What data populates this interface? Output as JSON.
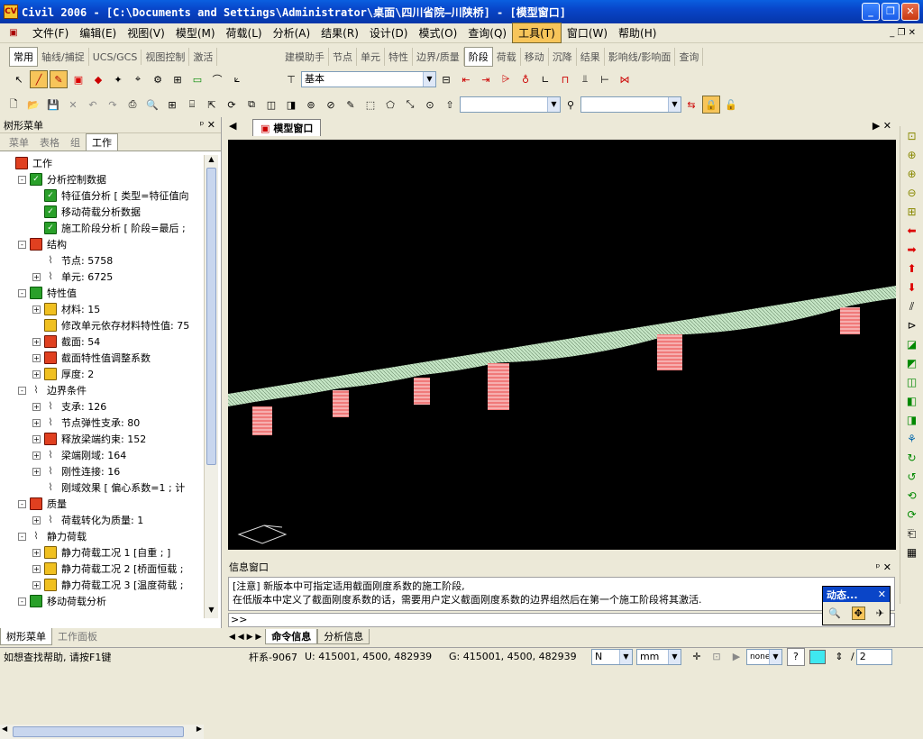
{
  "window": {
    "title": "Civil 2006 - [C:\\Documents and Settings\\Administrator\\桌面\\四川省院—川陕桥] - [模型窗口]"
  },
  "menu": [
    "文件(F)",
    "编辑(E)",
    "视图(V)",
    "模型(M)",
    "荷载(L)",
    "分析(A)",
    "结果(R)",
    "设计(D)",
    "模式(O)",
    "查询(Q)",
    "工具(T)",
    "窗口(W)",
    "帮助(H)"
  ],
  "active_menu": "工具(T)",
  "tabs_left": [
    "常用",
    "轴线/捕捉",
    "UCS/GCS",
    "视图控制",
    "激活"
  ],
  "tabs_right": [
    "建模助手",
    "节点",
    "单元",
    "特性",
    "边界/质量",
    "阶段",
    "荷载",
    "移动",
    "沉降",
    "结果",
    "影响线/影响面",
    "查询"
  ],
  "active_tab_right": "阶段",
  "stage_select": "基本",
  "tree_panel": {
    "title": "树形菜单",
    "tabs": [
      "菜单",
      "表格",
      "组",
      "工作"
    ],
    "active_tab": "工作",
    "items": [
      {
        "label": "工作",
        "level": 0,
        "expand": "",
        "icon": "red"
      },
      {
        "label": "分析控制数据",
        "level": 1,
        "expand": "-",
        "icon": "chk"
      },
      {
        "label": "特征值分析 [ 类型=特征值向",
        "level": 2,
        "expand": "",
        "icon": "chk"
      },
      {
        "label": "移动荷载分析数据",
        "level": 2,
        "expand": "",
        "icon": "chk"
      },
      {
        "label": "施工阶段分析 [ 阶段=最后 ;",
        "level": 2,
        "expand": "",
        "icon": "chk"
      },
      {
        "label": "结构",
        "level": 1,
        "expand": "-",
        "icon": "red"
      },
      {
        "label": "节点: 5758",
        "level": 2,
        "expand": "",
        "icon": "line"
      },
      {
        "label": "单元: 6725",
        "level": 2,
        "expand": "+",
        "icon": "line"
      },
      {
        "label": "特性值",
        "level": 1,
        "expand": "-",
        "icon": "green"
      },
      {
        "label": "材料: 15",
        "level": 2,
        "expand": "+",
        "icon": "yellow"
      },
      {
        "label": "修改单元依存材料特性值: 75",
        "level": 2,
        "expand": "",
        "icon": "yellow"
      },
      {
        "label": "截面: 54",
        "level": 2,
        "expand": "+",
        "icon": "red"
      },
      {
        "label": "截面特性值调整系数",
        "level": 2,
        "expand": "+",
        "icon": "red"
      },
      {
        "label": "厚度: 2",
        "level": 2,
        "expand": "+",
        "icon": "yellow"
      },
      {
        "label": "边界条件",
        "level": 1,
        "expand": "-",
        "icon": "line"
      },
      {
        "label": "支承: 126",
        "level": 2,
        "expand": "+",
        "icon": "line"
      },
      {
        "label": "节点弹性支承: 80",
        "level": 2,
        "expand": "+",
        "icon": "line"
      },
      {
        "label": "释放梁端约束: 152",
        "level": 2,
        "expand": "+",
        "icon": "red"
      },
      {
        "label": "梁端刚域: 164",
        "level": 2,
        "expand": "+",
        "icon": "line"
      },
      {
        "label": "刚性连接: 16",
        "level": 2,
        "expand": "+",
        "icon": "line"
      },
      {
        "label": "刚域效果 [ 偏心系数=1 ; 计",
        "level": 2,
        "expand": "",
        "icon": "line"
      },
      {
        "label": "质量",
        "level": 1,
        "expand": "-",
        "icon": "red"
      },
      {
        "label": "荷载转化为质量: 1",
        "level": 2,
        "expand": "+",
        "icon": "line"
      },
      {
        "label": "静力荷载",
        "level": 1,
        "expand": "-",
        "icon": "line"
      },
      {
        "label": "静力荷载工况 1 [自重 ; ]",
        "level": 2,
        "expand": "+",
        "icon": "yellow"
      },
      {
        "label": "静力荷载工况 2 [桥面恒载 ;",
        "level": 2,
        "expand": "+",
        "icon": "yellow"
      },
      {
        "label": "静力荷载工况 3 [温度荷载 ;",
        "level": 2,
        "expand": "+",
        "icon": "yellow"
      },
      {
        "label": "移动荷载分析",
        "level": 1,
        "expand": "-",
        "icon": "green"
      }
    ],
    "bottom_tabs": [
      "树形菜单",
      "工作面板"
    ],
    "active_bottom_tab": "树形菜单"
  },
  "doc_tab": "模型窗口",
  "info": {
    "title": "信息窗口",
    "lines": [
      "[注意] 新版本中可指定适用截面刚度系数的施工阶段,",
      "在低版本中定义了截面刚度系数的话，需要用户定义截面刚度系数的边界组然后在第一个施工阶段将其激活."
    ],
    "prompt": ">>",
    "tabs": [
      "命令信息",
      "分析信息"
    ],
    "active_tab": "命令信息"
  },
  "dynamic": {
    "title": "动态..."
  },
  "status": {
    "help": "如想查找帮助, 请按F1键",
    "coord_sys": "杆系-9067",
    "u_coord": "U: 415001, 4500, 482939",
    "g_coord": "G: 415001, 4500, 482939",
    "force_unit": "N",
    "length_unit": "mm",
    "snap": "none",
    "page": "2"
  },
  "colors": {
    "bridge": "#c6e6c6",
    "piers": "#f07a7a",
    "background": "#000000",
    "title_bar": "#0845c9"
  }
}
